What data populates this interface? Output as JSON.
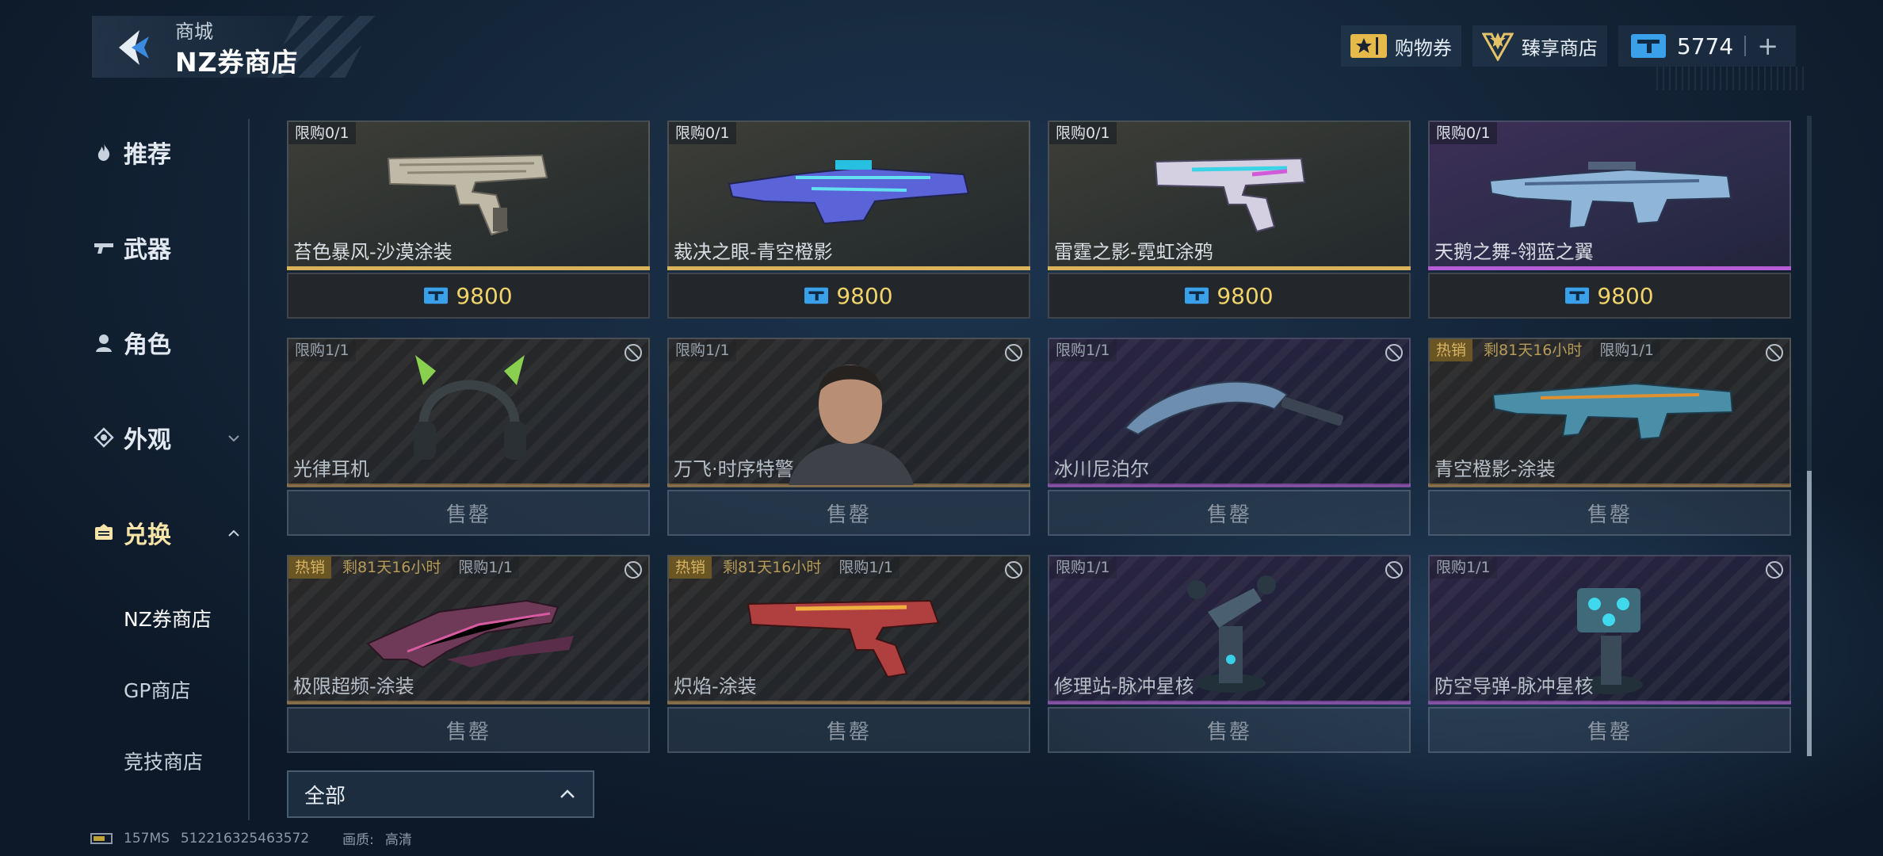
{
  "header": {
    "breadcrumb_parent": "商城",
    "title": "NZ券商店",
    "coupon_label": "购物券",
    "premium_shop_label": "臻享商店",
    "currency_amount": "5774",
    "plus_label": "+"
  },
  "sidebar": {
    "items": [
      {
        "label": "推荐",
        "icon": "flame-icon"
      },
      {
        "label": "武器",
        "icon": "gun-icon"
      },
      {
        "label": "角色",
        "icon": "person-icon"
      },
      {
        "label": "外观",
        "icon": "appearance-icon",
        "expandable": true
      },
      {
        "label": "兑换",
        "icon": "exchange-icon",
        "expanded": true,
        "active": true
      }
    ],
    "sub_items": [
      {
        "label": "NZ券商店",
        "active": true
      },
      {
        "label": "GP商店"
      },
      {
        "label": "竞技商店"
      }
    ]
  },
  "items": [
    {
      "name": "苔色暴风-沙漠涂装",
      "limit": "限购0/1",
      "price": "9800",
      "rarity": "gold",
      "sold_out": false
    },
    {
      "name": "裁决之眼-青空橙影",
      "limit": "限购0/1",
      "price": "9800",
      "rarity": "gold",
      "sold_out": false
    },
    {
      "name": "雷霆之影-霓虹涂鸦",
      "limit": "限购0/1",
      "price": "9800",
      "rarity": "gold",
      "sold_out": false
    },
    {
      "name": "天鹅之舞-翎蓝之翼",
      "limit": "限购0/1",
      "price": "9800",
      "rarity": "purple",
      "sold_out": false
    },
    {
      "name": "光律耳机",
      "limit": "限购1/1",
      "status": "售罄",
      "rarity": "orange",
      "sold_out": true
    },
    {
      "name": "万飞·时序特警",
      "limit": "限购1/1",
      "status": "售罄",
      "rarity": "orange",
      "sold_out": true
    },
    {
      "name": "冰川尼泊尔",
      "limit": "限购1/1",
      "status": "售罄",
      "rarity": "purple",
      "sold_out": true
    },
    {
      "name": "青空橙影-涂装",
      "hot": "热销",
      "time_left": "剩81天16小时",
      "limit": "限购1/1",
      "status": "售罄",
      "rarity": "orange",
      "sold_out": true
    },
    {
      "name": "极限超频-涂装",
      "hot": "热销",
      "time_left": "剩81天16小时",
      "limit": "限购1/1",
      "status": "售罄",
      "rarity": "orange",
      "sold_out": true
    },
    {
      "name": "炽焰-涂装",
      "hot": "热销",
      "time_left": "剩81天16小时",
      "limit": "限购1/1",
      "status": "售罄",
      "rarity": "orange",
      "sold_out": true
    },
    {
      "name": "修理站-脉冲星核",
      "limit": "限购1/1",
      "status": "售罄",
      "rarity": "purple",
      "sold_out": true
    },
    {
      "name": "防空导弹-脉冲星核",
      "limit": "限购1/1",
      "status": "售罄",
      "rarity": "purple",
      "sold_out": true
    }
  ],
  "filter": {
    "selected": "全部"
  },
  "status_bar": {
    "ping": "157MS",
    "uid": "512216325463572",
    "quality_label": "画质:",
    "quality_value": "高清"
  },
  "colors": {
    "price": "#f0d46a",
    "gold_rarity": "#d9b25a",
    "purple_rarity": "#b55cd6",
    "hot_tag": "#6a5524",
    "active_nav": "#f6e3a8"
  }
}
